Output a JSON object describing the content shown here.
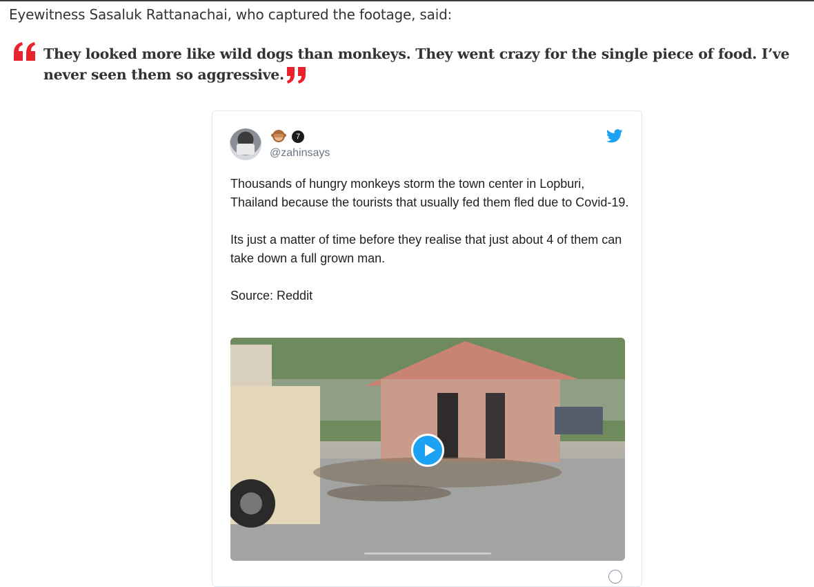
{
  "article": {
    "intro": "Eyewitness Sasaluk Rattanachai, who captured the footage, said:",
    "quote": "They looked more like wild dogs than monkeys. They went crazy for the single piece of food. I’ve never seen them so aggressive."
  },
  "colors": {
    "quote_mark": "#e8232e",
    "twitter_blue": "#1da1f2"
  },
  "tweet": {
    "badge_count": "7",
    "handle": "@zahinsays",
    "paragraphs": [
      "Thousands of hungry monkeys storm the town center in Lopburi, Thailand because the tourists that usually fed them fled due to Covid-19.",
      "Its just a matter of time before they realise that just about 4 of them can take down a full grown man.",
      "Source: Reddit"
    ],
    "icons": {
      "avatar": "avatar-photo",
      "emoji": "see-no-evil-monkey-icon",
      "brand": "twitter-bird-icon",
      "media": "play-icon",
      "footer": "info-icon"
    }
  }
}
